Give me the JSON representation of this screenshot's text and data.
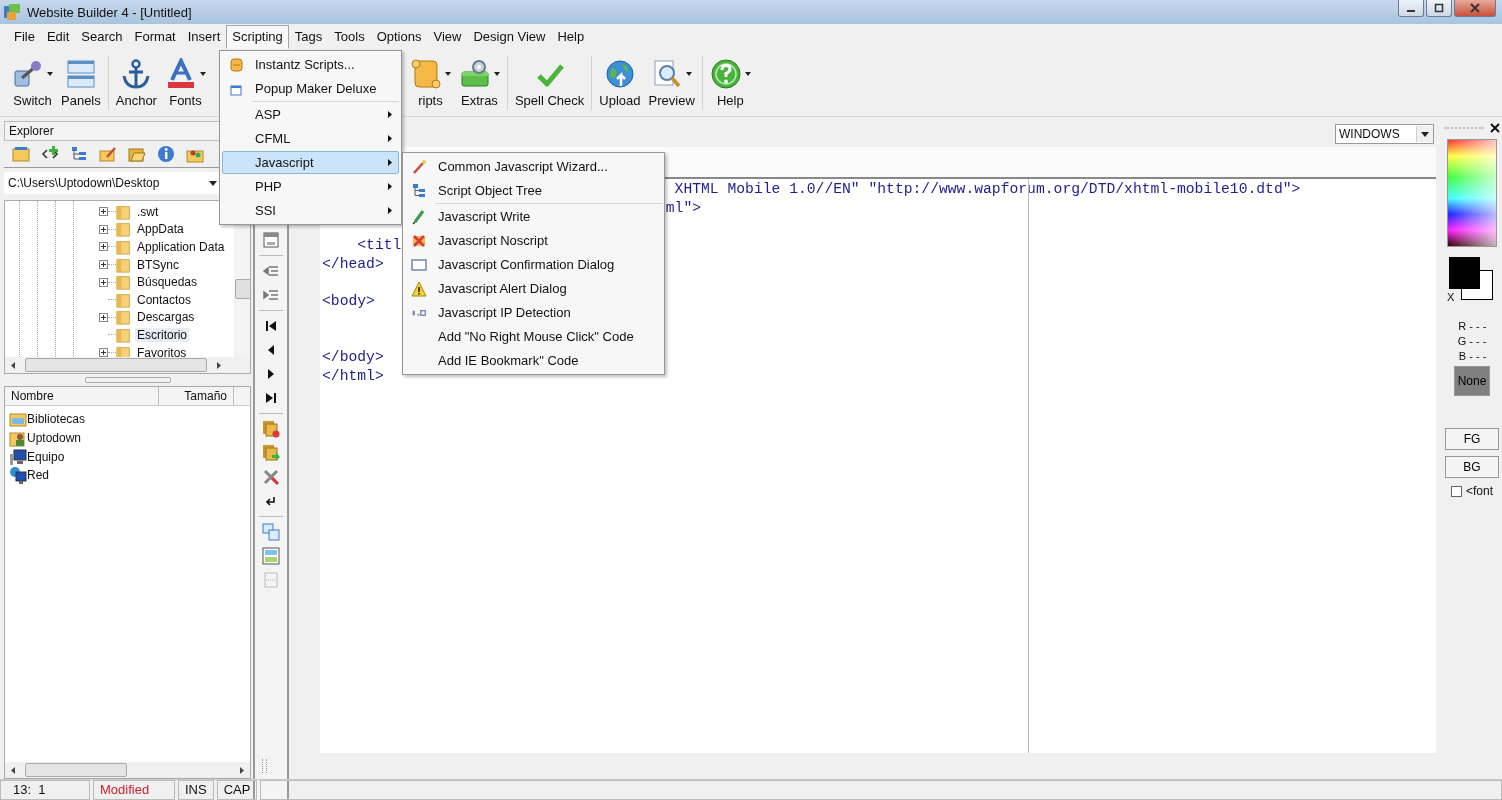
{
  "window": {
    "title": "Website Builder 4 - [Untitled]"
  },
  "menu_bar": [
    {
      "label": "File",
      "selected": false
    },
    {
      "label": "Edit",
      "selected": false
    },
    {
      "label": "Search",
      "selected": false
    },
    {
      "label": "Format",
      "selected": false
    },
    {
      "label": "Insert",
      "selected": false
    },
    {
      "label": "Scripting",
      "selected": true
    },
    {
      "label": "Tags",
      "selected": false
    },
    {
      "label": "Tools",
      "selected": false
    },
    {
      "label": "Options",
      "selected": false
    },
    {
      "label": "View",
      "selected": false
    },
    {
      "label": "Design View",
      "selected": false
    },
    {
      "label": "Help",
      "selected": false
    }
  ],
  "toolbar": [
    {
      "label": "Switch",
      "dropdown": true
    },
    {
      "label": "Panels",
      "dropdown": false
    },
    {
      "label": "Anchor",
      "dropdown": false
    },
    {
      "label": "Fonts",
      "dropdown": true
    },
    {
      "label": "ripts",
      "dropdown": true
    },
    {
      "label": "Extras",
      "dropdown": true
    },
    {
      "label": "Spell Check",
      "dropdown": false
    },
    {
      "label": "Upload",
      "dropdown": false
    },
    {
      "label": "Preview",
      "dropdown": true
    },
    {
      "label": "Help",
      "dropdown": true
    }
  ],
  "scripting_menu": [
    [
      {
        "label": "Instantz Scripts...",
        "submenu": false,
        "selected": false
      },
      {
        "label": "Popup Maker Deluxe",
        "submenu": false,
        "selected": false
      }
    ],
    [
      {
        "label": "ASP",
        "submenu": true,
        "selected": false
      },
      {
        "label": "CFML",
        "submenu": true,
        "selected": false
      },
      {
        "label": "Javascript",
        "submenu": true,
        "selected": true
      },
      {
        "label": "PHP",
        "submenu": true,
        "selected": false
      },
      {
        "label": "SSI",
        "submenu": true,
        "selected": false
      }
    ]
  ],
  "javascript_submenu": [
    [
      "Common Javascript Wizard...",
      "Script Object Tree"
    ],
    [
      "Javascript Write",
      "Javascript Noscript",
      "Javascript Confirmation Dialog",
      "Javascript Alert Dialog",
      "Javascript IP Detection",
      "Add \"No Right Mouse Click\" Code",
      "Add IE Bookmark\" Code"
    ]
  ],
  "explorer": {
    "title": "Explorer",
    "path": "C:\\Users\\Uptodown\\Desktop",
    "tree": [
      {
        "label": ".swt",
        "expandable": true,
        "selected": false
      },
      {
        "label": "AppData",
        "expandable": true,
        "selected": false
      },
      {
        "label": "Application Data",
        "expandable": true,
        "selected": false
      },
      {
        "label": "BTSync",
        "expandable": true,
        "selected": false
      },
      {
        "label": "Búsquedas",
        "expandable": true,
        "selected": false
      },
      {
        "label": "Contactos",
        "expandable": false,
        "selected": false
      },
      {
        "label": "Descargas",
        "expandable": true,
        "selected": false
      },
      {
        "label": "Escritorio",
        "expandable": false,
        "selected": true
      },
      {
        "label": "Favoritos",
        "expandable": true,
        "selected": false
      }
    ],
    "columns": [
      "Nombre",
      "Tamaño"
    ],
    "files": [
      "Bibliotecas",
      "Uptodown",
      "Equipo",
      "Red"
    ]
  },
  "editor": {
    "encoding": "WINDOWS",
    "blocks": [
      [
        "                                        XHTML Mobile 1.0//EN\" \"http://www.wapforum.org/DTD/xhtml-mobile10.dtd\">",
        "                                       ml\">"
      ],
      [
        "    <titl",
        "</head>"
      ],
      [
        "<body>"
      ],
      [
        "</body>",
        "</html>"
      ]
    ]
  },
  "color_panel": {
    "x_label": "X",
    "r": "R - - -",
    "g": "G - - -",
    "b": "B - - -",
    "none_button": "None",
    "fg_button": "FG",
    "bg_button": "BG",
    "font_checkbox": {
      "label": "<font",
      "checked": false
    }
  },
  "status_bar": {
    "position": "13:  1",
    "modified": "Modified",
    "insert": "INS",
    "caps": "CAP"
  }
}
